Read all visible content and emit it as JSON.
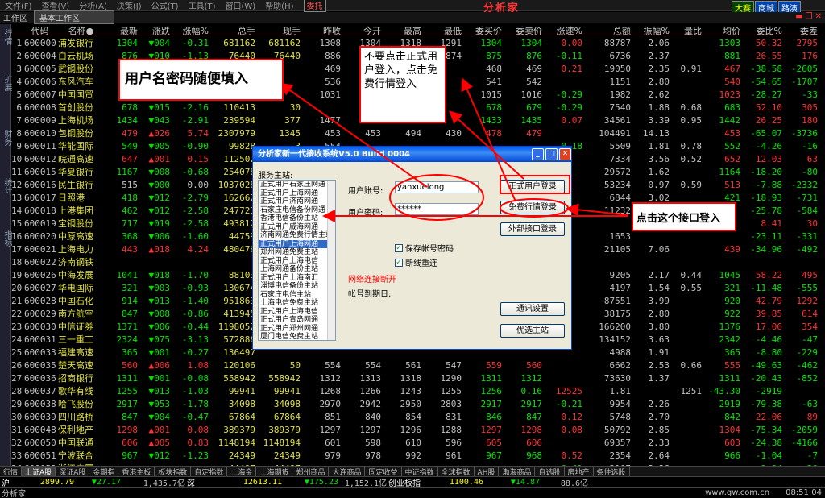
{
  "menubar": {
    "items": [
      "文件(F)",
      "查看(V)",
      "分析(A)",
      "决策(J)",
      "公式(T)",
      "工具(T)",
      "窗口(W)",
      "帮助(H)"
    ],
    "tag": "委托",
    "brand": "分析家",
    "right_buttons": [
      "大赛",
      "商城",
      "路演"
    ]
  },
  "tabbar": {
    "label": "工作区",
    "current": "基本工作区"
  },
  "leftbar": [
    "行情",
    "扩展",
    "财务",
    "统计",
    "指标"
  ],
  "columns": [
    "代码",
    "名称●",
    "最新",
    "涨跌",
    "涨幅%",
    "总手",
    "现手",
    "昨收",
    "今开",
    "最高",
    "最低",
    "委买价",
    "委卖价",
    "涨速%",
    "总额",
    "振幅%",
    "量比",
    "均价",
    "委比%",
    "委差"
  ],
  "rows": [
    [
      "1",
      "600000",
      "浦发银行",
      "1304",
      "▼004",
      "-0.31",
      "681162",
      "681162",
      "1308",
      "1304",
      "1318",
      "1291",
      "1304",
      "1304",
      "0.00",
      "88787",
      "2.06",
      "",
      "1303",
      "50.32",
      "2795"
    ],
    [
      "2",
      "600004",
      "白云机场",
      "876",
      "▼010",
      "-1.13",
      "76440",
      "76440",
      "886",
      "886",
      "895",
      "874",
      "875",
      "876",
      "-0.11",
      "6736",
      "2.37",
      "",
      "881",
      "26.55",
      "176"
    ],
    [
      "3",
      "600005",
      "武钢股份",
      "",
      "",
      "",
      "",
      "",
      "469",
      "",
      "",
      "",
      "468",
      "469",
      "0.21",
      "19050",
      "2.35",
      "0.91",
      "467",
      "-38.58",
      "-2605"
    ],
    [
      "4",
      "600006",
      "东风汽车",
      "",
      "",
      "",
      "",
      "",
      "536",
      "",
      "",
      "",
      "541",
      "542",
      "",
      "1151",
      "2.80",
      "",
      "540",
      "-54.65",
      "-1707"
    ],
    [
      "5",
      "600007",
      "中国国贸",
      "",
      "",
      "",
      "",
      "",
      "1031",
      "",
      "",
      "",
      "1015",
      "1016",
      "-0.29",
      "1982",
      "2.62",
      "",
      "1023",
      "-28.27",
      "-33"
    ],
    [
      "6",
      "600008",
      "首创股份",
      "678",
      "▼015",
      "-2.16",
      "110413",
      "30",
      "",
      "",
      "",
      "",
      "678",
      "679",
      "-0.29",
      "7540",
      "1.88",
      "0.68",
      "683",
      "52.10",
      "305"
    ],
    [
      "7",
      "600009",
      "上海机场",
      "1434",
      "▼043",
      "-2.91",
      "239594",
      "377",
      "1477",
      "",
      "",
      "",
      "1433",
      "1435",
      "0.07",
      "34561",
      "3.39",
      "0.95",
      "1442",
      "26.25",
      "180"
    ],
    [
      "8",
      "600010",
      "包钢股份",
      "479",
      "▲026",
      "5.74",
      "2307979",
      "1345",
      "453",
      "453",
      "494",
      "430",
      "478",
      "479",
      "",
      "104491",
      "14.13",
      "",
      "453",
      "-65.07",
      "-3736"
    ],
    [
      "9",
      "600011",
      "华能国际",
      "549",
      "▼005",
      "-0.90",
      "99828",
      "3",
      "554",
      "",
      "",
      "",
      "",
      "",
      "-0.18",
      "5509",
      "1.81",
      "0.78",
      "552",
      "-4.26",
      "-16"
    ],
    [
      "10",
      "600012",
      "皖通高速",
      "647",
      "▲001",
      "0.15",
      "112502",
      "",
      "",
      "",
      "",
      "",
      "",
      "",
      "",
      "7334",
      "3.56",
      "0.52",
      "652",
      "12.03",
      "63"
    ],
    [
      "11",
      "600015",
      "华夏银行",
      "1167",
      "▼008",
      "-0.68",
      "254078",
      "",
      "",
      "",
      "",
      "",
      "",
      "",
      "",
      "29572",
      "1.62",
      "",
      "1164",
      "-18.20",
      "-80"
    ],
    [
      "12",
      "600016",
      "民生银行",
      "515",
      "▼000",
      "0.00",
      "1037028",
      "",
      "",
      "",
      "",
      "",
      "",
      "",
      "",
      "53234",
      "0.97",
      "0.59",
      "513",
      "-7.88",
      "-2332"
    ],
    [
      "13",
      "600017",
      "日照港",
      "418",
      "▼012",
      "-2.79",
      "162662",
      "",
      "",
      "",
      "",
      "",
      "",
      "",
      "",
      "6844",
      "3.02",
      "",
      "421",
      "-18.93",
      "-731"
    ],
    [
      "14",
      "600018",
      "上港集团",
      "462",
      "▼012",
      "-2.58",
      "247723",
      "",
      "",
      "",
      "",
      "",
      "",
      "",
      "",
      "11232",
      "",
      "",
      "",
      "-25.78",
      "-584"
    ],
    [
      "15",
      "600019",
      "宝钢股份",
      "717",
      "▼019",
      "-2.58",
      "493812",
      "",
      "",
      "",
      "",
      "",
      "",
      "",
      "",
      "",
      "",
      "",
      "",
      "8.41",
      "30"
    ],
    [
      "16",
      "600020",
      "中原高速",
      "368",
      "▼006",
      "-1.60",
      "44759",
      "",
      "",
      "",
      "",
      "",
      "",
      "",
      "",
      "1653",
      "",
      "",
      "",
      "-23.11",
      "-331"
    ],
    [
      "17",
      "600021",
      "上海电力",
      "443",
      "▲018",
      "4.24",
      "480476",
      "",
      "",
      "",
      "",
      "",
      "",
      "",
      "",
      "21105",
      "7.06",
      "",
      "439",
      "-34.96",
      "-492"
    ],
    [
      "18",
      "600022",
      "济南钢铁",
      "",
      "",
      "",
      "",
      "",
      "",
      "",
      "",
      "",
      "",
      "",
      "",
      "",
      "",
      "",
      "",
      "",
      ""
    ],
    [
      "19",
      "600026",
      "中海发展",
      "1041",
      "▼018",
      "-1.70",
      "88103",
      "",
      "",
      "",
      "",
      "",
      "",
      "",
      "",
      "9205",
      "2.17",
      "0.44",
      "1045",
      "58.22",
      "495"
    ],
    [
      "20",
      "600027",
      "华电国际",
      "321",
      "▼003",
      "-0.93",
      "130674",
      "",
      "",
      "",
      "",
      "",
      "",
      "",
      "",
      "4197",
      "1.54",
      "0.55",
      "321",
      "-11.48",
      "-555"
    ],
    [
      "21",
      "600028",
      "中国石化",
      "914",
      "▼013",
      "-1.40",
      "951863",
      "",
      "",
      "",
      "",
      "",
      "",
      "",
      "",
      "87551",
      "3.99",
      "",
      "920",
      "42.79",
      "1292"
    ],
    [
      "22",
      "600029",
      "南方航空",
      "847",
      "▼008",
      "-0.86",
      "413945",
      "",
      "",
      "",
      "",
      "",
      "",
      "",
      "",
      "38175",
      "2.80",
      "",
      "922",
      "39.85",
      "614"
    ],
    [
      "23",
      "600030",
      "中信证券",
      "1371",
      "▼006",
      "-0.44",
      "1198052",
      "",
      "",
      "",
      "",
      "",
      "",
      "",
      "",
      "166200",
      "3.80",
      "",
      "1376",
      "17.06",
      "354"
    ],
    [
      "24",
      "600031",
      "三一重工",
      "2324",
      "▼075",
      "-3.13",
      "572886",
      "",
      "",
      "",
      "",
      "",
      "",
      "",
      "",
      "134152",
      "3.63",
      "",
      "2342",
      "-4.46",
      "-47"
    ],
    [
      "25",
      "600033",
      "福建高速",
      "365",
      "▼001",
      "-0.27",
      "136497",
      "",
      "",
      "",
      "",
      "",
      "",
      "",
      "",
      "4988",
      "1.91",
      "",
      "365",
      "-8.80",
      "-229"
    ],
    [
      "26",
      "600035",
      "楚天高速",
      "560",
      "▲006",
      "1.08",
      "120106",
      "50",
      "554",
      "554",
      "561",
      "547",
      "559",
      "560",
      "",
      "6662",
      "2.53",
      "0.66",
      "555",
      "-49.63",
      "-462"
    ],
    [
      "27",
      "600036",
      "招商银行",
      "1311",
      "▼001",
      "-0.08",
      "558942",
      "558942",
      "1312",
      "1313",
      "1318",
      "1290",
      "1311",
      "1312",
      "",
      "73630",
      "1.37",
      "",
      "1311",
      "-20.43",
      "-852"
    ],
    [
      "28",
      "600037",
      "歌华有线",
      "1255",
      "▼013",
      "-1.03",
      "99941",
      "99941",
      "1268",
      "1266",
      "1243",
      "1255",
      "1256",
      "0.16",
      "12525",
      "1.81",
      "",
      "1251",
      "-43.30",
      "-2919"
    ],
    [
      "29",
      "600038",
      "哈飞股份",
      "2917",
      "▼053",
      "-1.78",
      "34098",
      "34098",
      "2970",
      "2942",
      "2950",
      "2803",
      "2917",
      "2917",
      "-0.21",
      "9954",
      "2.26",
      "",
      "2919",
      "-79.38",
      "-63"
    ],
    [
      "30",
      "600039",
      "四川路桥",
      "847",
      "▼004",
      "-0.47",
      "67864",
      "67864",
      "851",
      "840",
      "854",
      "831",
      "846",
      "847",
      "0.12",
      "5748",
      "2.70",
      "",
      "842",
      "22.06",
      "89"
    ],
    [
      "31",
      "600048",
      "保利地产",
      "1298",
      "▲001",
      "0.08",
      "389379",
      "389379",
      "1297",
      "1297",
      "1296",
      "1288",
      "1297",
      "1298",
      "0.08",
      "50792",
      "2.85",
      "",
      "1304",
      "-75.34",
      "-2059"
    ],
    [
      "32",
      "600050",
      "中国联通",
      "606",
      "▲005",
      "0.83",
      "1148194",
      "1148194",
      "601",
      "598",
      "610",
      "596",
      "605",
      "606",
      "",
      "69357",
      "2.33",
      "",
      "603",
      "-24.38",
      "-4166"
    ],
    [
      "33",
      "600051",
      "宁波联合",
      "967",
      "▼012",
      "-1.23",
      "24349",
      "24349",
      "979",
      "978",
      "992",
      "961",
      "967",
      "968",
      "0.52",
      "2354",
      "2.64",
      "",
      "966",
      "-1.04",
      "-7"
    ],
    [
      "34",
      "600052",
      "浙江广厦",
      "",
      "",
      "",
      "44497",
      "44497",
      "",
      "",
      "",
      "",
      "",
      "",
      "-0.41",
      "2167",
      "2.26",
      "",
      "",
      "-1.04",
      "-20"
    ]
  ],
  "bottomtabs": [
    "行情",
    "上证A股",
    "深证A股",
    "金期指",
    "香港主板",
    "板块指数",
    "自定指数",
    "上海金",
    "上海期货",
    "郑州商品",
    "大连商品",
    "固定收益",
    "中证指数",
    "全球指数",
    "AH股",
    "渤海商品",
    "自选股",
    "房地产",
    "条件选股"
  ],
  "status1": [
    "沪",
    "2899.79",
    "▼27.17",
    "1,435.7亿",
    "深",
    "12613.11",
    "▼175.23",
    "1,152.1亿",
    "创业板指",
    "1100.46",
    "▼14.87",
    "88.6亿"
  ],
  "status2": {
    "left": "分析家",
    "url": "www.gw.com.cn",
    "time": "08:51:04"
  },
  "dialog": {
    "title": "分析家新一代接收系统V5.0 Build 0004",
    "server_label": "服务主站:",
    "servers": [
      "正式用户石家庄网通",
      "正式用户上海网通",
      "正式用户济南网通",
      "石家庄电信备份网通",
      "香港电信备份主站",
      "正式用户威海网通",
      "济南网通免费行情主站",
      "正式用户上海网通",
      "郑州网通免费主站",
      "正式用户上海电信",
      "上海网通备份主站",
      "正式用户上海南汇",
      "淄博电信备份主站",
      "石家庄电信主站",
      "上海电信免费主站",
      "正式用户上海电信",
      "正式用户青岛网通",
      "正式用户郑州网通",
      "厦门电信免费主站",
      "正式用户长沙电信",
      "长沙网通免费主站",
      "正式用户上海电信",
      "重庆电信免费主站",
      "正式用户大连网通",
      "正式用户上海网通",
      "珠海电信免费主站",
      "正式用户上海电信",
      "正式用户上海网通"
    ],
    "selected_index": 7,
    "account_label": "用户账号:",
    "account_value": "yanxuelong",
    "password_label": "用户密码:",
    "password_value": "******",
    "btn_formal": "正式用户登录",
    "btn_free": "免费行情登录",
    "btn_external": "外部接口登录",
    "chk_save": "保存帐号密码",
    "chk_reconnect": "断线重连",
    "net_status": "网络连接断开",
    "expire_label": "帐号到期日:",
    "btn_comm": "通讯设置",
    "btn_select": "优选主站"
  },
  "callouts": {
    "username": "用户名密码随便填入",
    "dont_click": "不要点击正式用户登入，点击免费行情登入",
    "click_here": "点击这个接口登入"
  }
}
